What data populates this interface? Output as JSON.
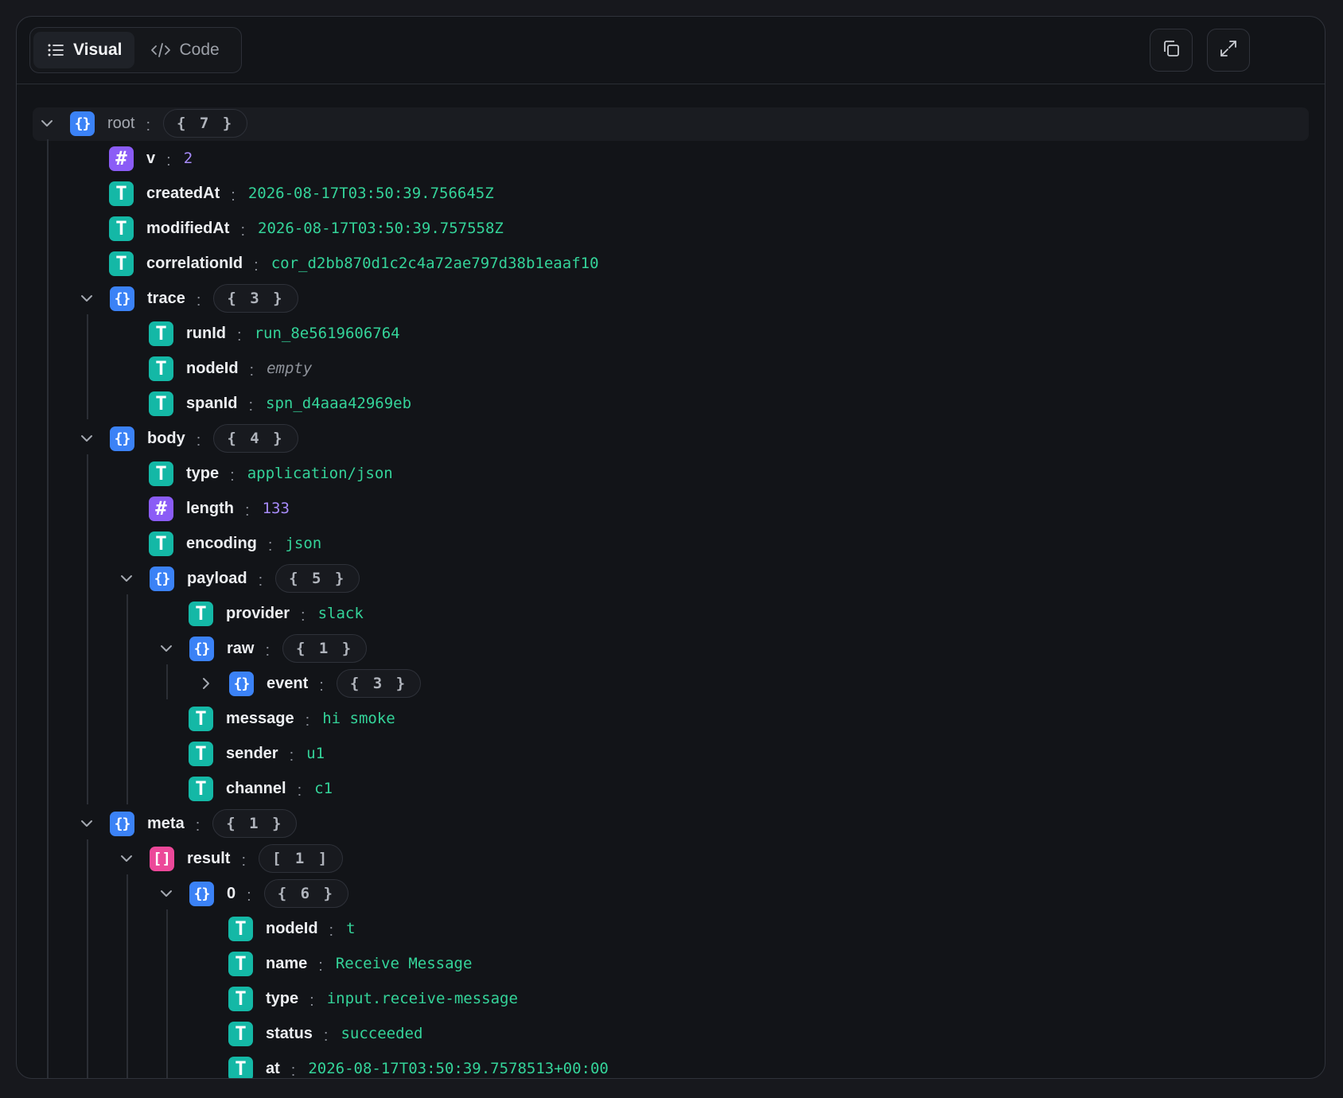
{
  "toolbar": {
    "tabs": [
      {
        "label": "Visual",
        "icon": "list-icon",
        "active": true
      },
      {
        "label": "Code",
        "icon": "code-icon",
        "active": false
      }
    ],
    "buttons": [
      {
        "name": "copy-button",
        "icon": "copy-icon"
      },
      {
        "name": "expand-button",
        "icon": "expand-icon"
      }
    ]
  },
  "colors": {
    "object_badge": "#3b82f6",
    "string_badge": "#14b8a6",
    "number_badge": "#8b5cf6",
    "array_badge": "#ec4899",
    "string_value": "#34d399",
    "number_value": "#a78bfa"
  },
  "tree": [
    {
      "key": "root",
      "type": "object",
      "count": "{ 7 }",
      "depth": 0,
      "expanded": true
    },
    {
      "key": "v",
      "type": "number",
      "value": "2",
      "depth": 1
    },
    {
      "key": "createdAt",
      "type": "string",
      "value": "2026-08-17T03:50:39.756645Z",
      "depth": 1
    },
    {
      "key": "modifiedAt",
      "type": "string",
      "value": "2026-08-17T03:50:39.757558Z",
      "depth": 1
    },
    {
      "key": "correlationId",
      "type": "string",
      "value": "cor_d2bb870d1c2c4a72ae797d38b1eaaf10",
      "depth": 1
    },
    {
      "key": "trace",
      "type": "object",
      "count": "{ 3 }",
      "depth": 1,
      "expanded": true
    },
    {
      "key": "runId",
      "type": "string",
      "value": "run_8e5619606764",
      "depth": 2
    },
    {
      "key": "nodeId",
      "type": "empty",
      "value": "empty",
      "depth": 2
    },
    {
      "key": "spanId",
      "type": "string",
      "value": "spn_d4aaa42969eb",
      "depth": 2
    },
    {
      "key": "body",
      "type": "object",
      "count": "{ 4 }",
      "depth": 1,
      "expanded": true
    },
    {
      "key": "type",
      "type": "string",
      "value": "application/json",
      "depth": 2
    },
    {
      "key": "length",
      "type": "number",
      "value": "133",
      "depth": 2
    },
    {
      "key": "encoding",
      "type": "string",
      "value": "json",
      "depth": 2
    },
    {
      "key": "payload",
      "type": "object",
      "count": "{ 5 }",
      "depth": 2,
      "expanded": true
    },
    {
      "key": "provider",
      "type": "string",
      "value": "slack",
      "depth": 3
    },
    {
      "key": "raw",
      "type": "object",
      "count": "{ 1 }",
      "depth": 3,
      "expanded": true
    },
    {
      "key": "event",
      "type": "object",
      "count": "{ 3 }",
      "depth": 4,
      "expanded": false
    },
    {
      "key": "message",
      "type": "string",
      "value": "hi smoke",
      "depth": 3
    },
    {
      "key": "sender",
      "type": "string",
      "value": "u1",
      "depth": 3
    },
    {
      "key": "channel",
      "type": "string",
      "value": "c1",
      "depth": 3
    },
    {
      "key": "meta",
      "type": "object",
      "count": "{ 1 }",
      "depth": 1,
      "expanded": true
    },
    {
      "key": "result",
      "type": "array",
      "count": "[ 1 ]",
      "depth": 2,
      "expanded": true
    },
    {
      "key": "0",
      "type": "object",
      "count": "{ 6 }",
      "depth": 3,
      "expanded": true
    },
    {
      "key": "nodeId",
      "type": "string",
      "value": "t",
      "depth": 4
    },
    {
      "key": "name",
      "type": "string",
      "value": "Receive Message",
      "depth": 4
    },
    {
      "key": "type",
      "type": "string",
      "value": "input.receive-message",
      "depth": 4
    },
    {
      "key": "status",
      "type": "string",
      "value": "succeeded",
      "depth": 4
    },
    {
      "key": "at",
      "type": "string",
      "value": "2026-08-17T03:50:39.7578513+00:00",
      "depth": 4
    }
  ]
}
